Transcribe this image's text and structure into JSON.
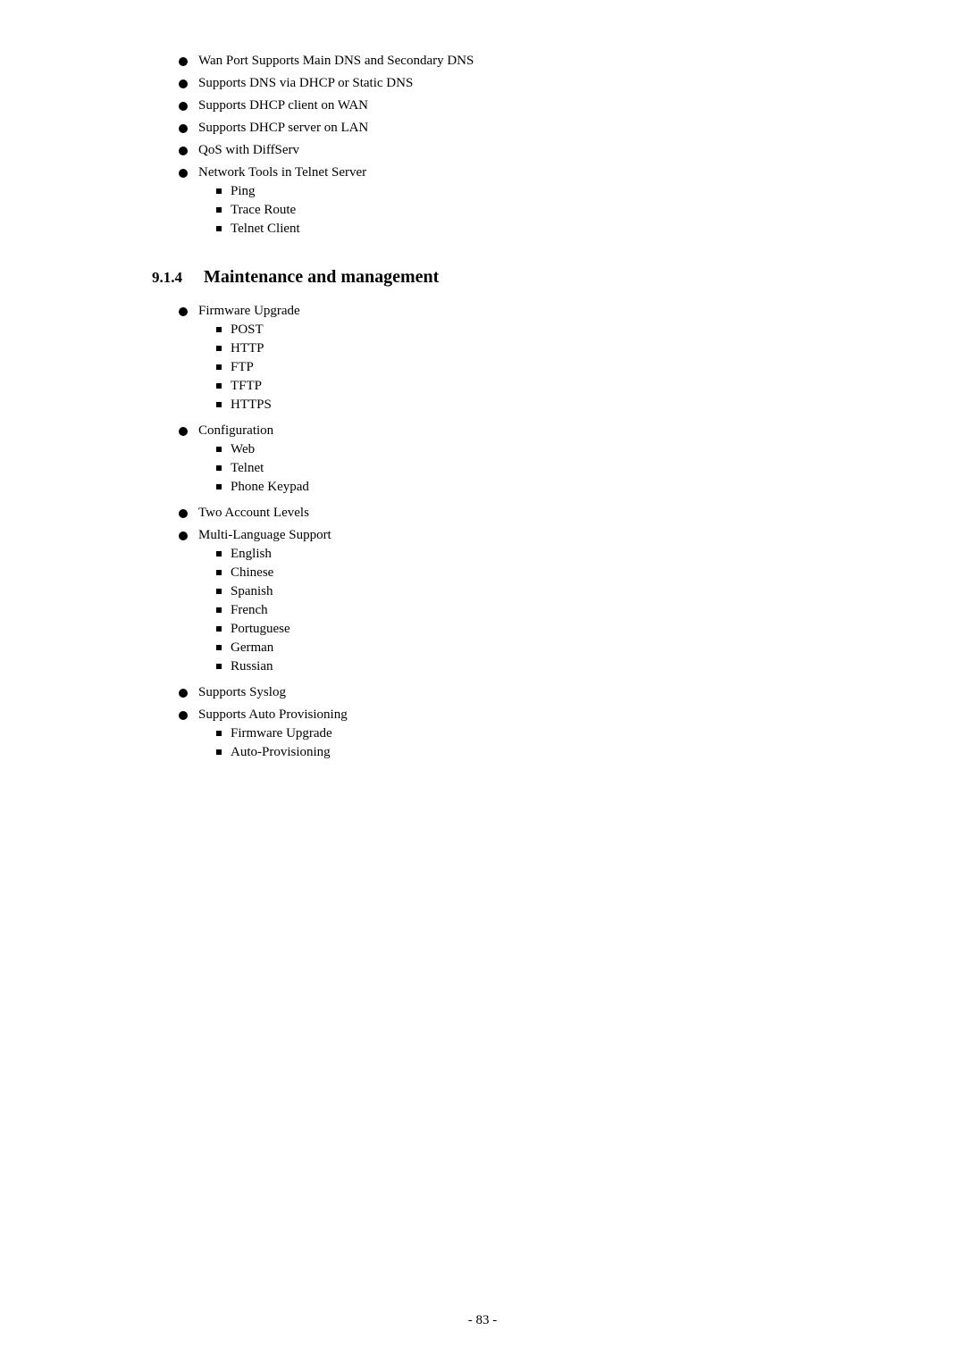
{
  "page": {
    "topBullets": [
      "Wan Port Supports Main DNS and Secondary DNS",
      "Supports DNS via DHCP or Static DNS",
      "Supports DHCP client on WAN",
      "Supports DHCP server on LAN",
      "QoS with DiffServ",
      "Network Tools in Telnet Server"
    ],
    "networkToolsSubs": [
      "Ping",
      "Trace Route",
      "Telnet Client"
    ],
    "section": {
      "number": "9.1.4",
      "title": "Maintenance and management"
    },
    "maintenanceBullets": [
      {
        "label": "Firmware Upgrade",
        "subs": [
          "POST",
          "HTTP",
          "FTP",
          "TFTP",
          "HTTPS"
        ]
      },
      {
        "label": "Configuration",
        "subs": [
          "Web",
          "Telnet",
          "Phone Keypad"
        ]
      },
      {
        "label": "Two Account Levels",
        "subs": []
      },
      {
        "label": "Multi-Language Support",
        "subs": [
          "English",
          "Chinese",
          "Spanish",
          "French",
          "Portuguese",
          "German",
          "Russian"
        ]
      },
      {
        "label": "Supports Syslog",
        "subs": []
      },
      {
        "label": "Supports Auto Provisioning",
        "subs": [
          "Firmware Upgrade",
          "Auto-Provisioning"
        ]
      }
    ],
    "footer": "- 83 -"
  }
}
